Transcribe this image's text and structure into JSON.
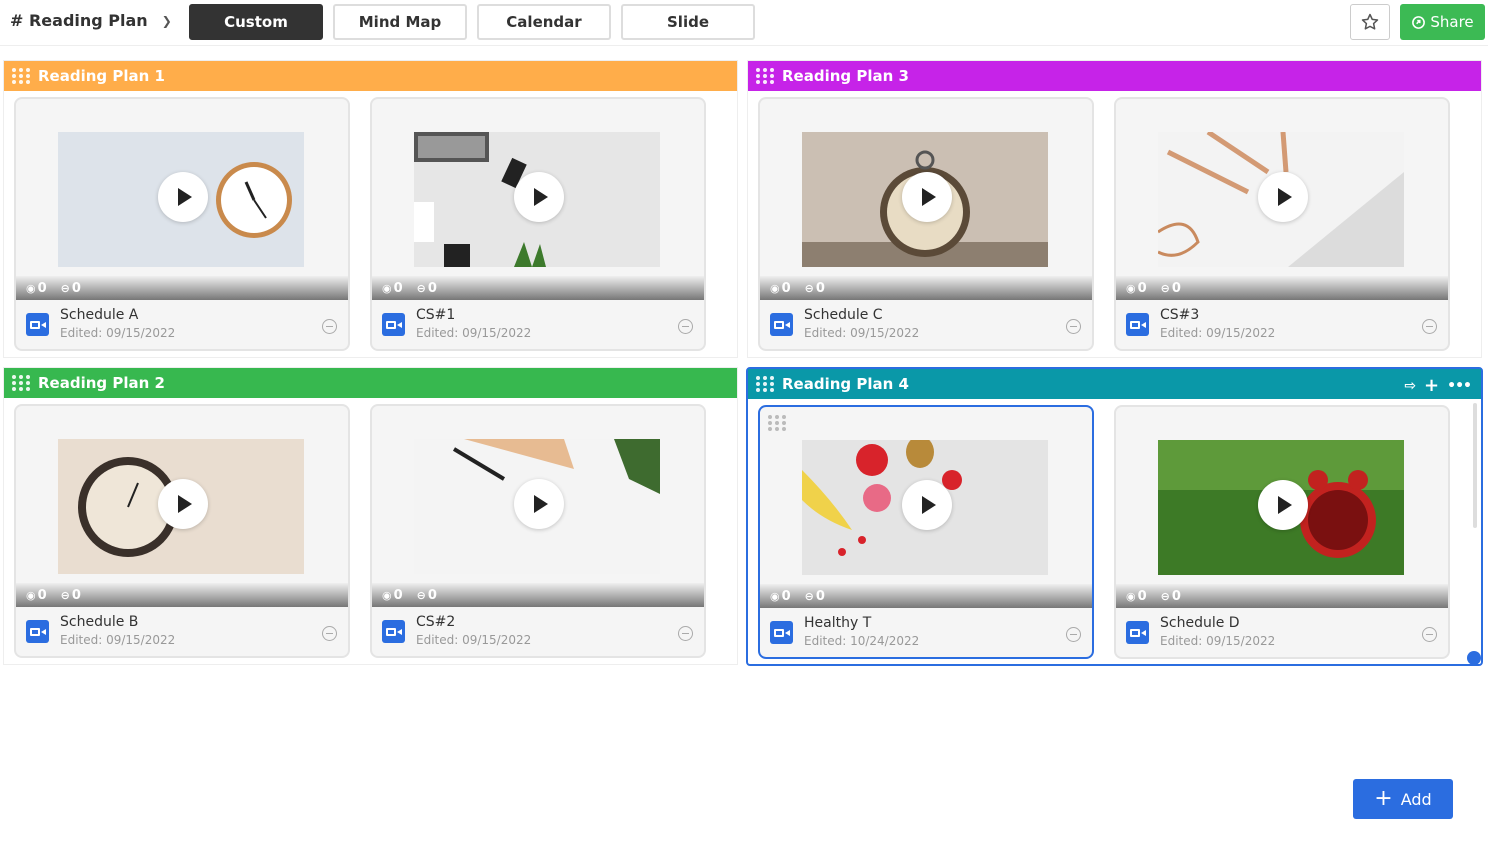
{
  "toolbar": {
    "board_title": "# Reading Plan",
    "views": [
      "Custom",
      "Mind Map",
      "Calendar",
      "Slide"
    ],
    "share_label": "Share",
    "colors": {
      "active_view": "#333333",
      "share": "#3cba54",
      "accent": "#2b6de0"
    }
  },
  "groups": [
    {
      "title": "Reading Plan 1",
      "color": "#ffad4a",
      "cards": [
        {
          "title": "Schedule A",
          "date": "Edited: 09/15/2022",
          "views": "0",
          "comments": "0",
          "image": "clock-on-wall"
        },
        {
          "title": "CS#1",
          "date": "Edited: 09/15/2022",
          "views": "0",
          "comments": "0",
          "image": "desk-keyboard"
        }
      ]
    },
    {
      "title": "Reading Plan 3",
      "color": "#c623e8",
      "cards": [
        {
          "title": "Schedule C",
          "date": "Edited: 09/15/2022",
          "views": "0",
          "comments": "0",
          "image": "pocket-clock"
        },
        {
          "title": "CS#3",
          "date": "Edited: 09/15/2022",
          "views": "0",
          "comments": "0",
          "image": "pencils-keyboard"
        }
      ]
    },
    {
      "title": "Reading Plan 2",
      "color": "#37b84f",
      "cards": [
        {
          "title": "Schedule B",
          "date": "Edited: 09/15/2022",
          "views": "0",
          "comments": "0",
          "image": "roman-clock"
        },
        {
          "title": "CS#2",
          "date": "Edited: 09/15/2022",
          "views": "0",
          "comments": "0",
          "image": "notebook-plant"
        }
      ]
    },
    {
      "title": "Reading Plan 4",
      "color": "#0a98a8",
      "cards": [
        {
          "title": "Healthy T",
          "date": "Edited: 10/24/2022",
          "views": "0",
          "comments": "0",
          "image": "fruit-smoothie"
        },
        {
          "title": "Schedule D",
          "date": "Edited: 09/15/2022",
          "views": "0",
          "comments": "0",
          "image": "alarm-clock-grass"
        }
      ]
    }
  ],
  "add_label": "Add"
}
